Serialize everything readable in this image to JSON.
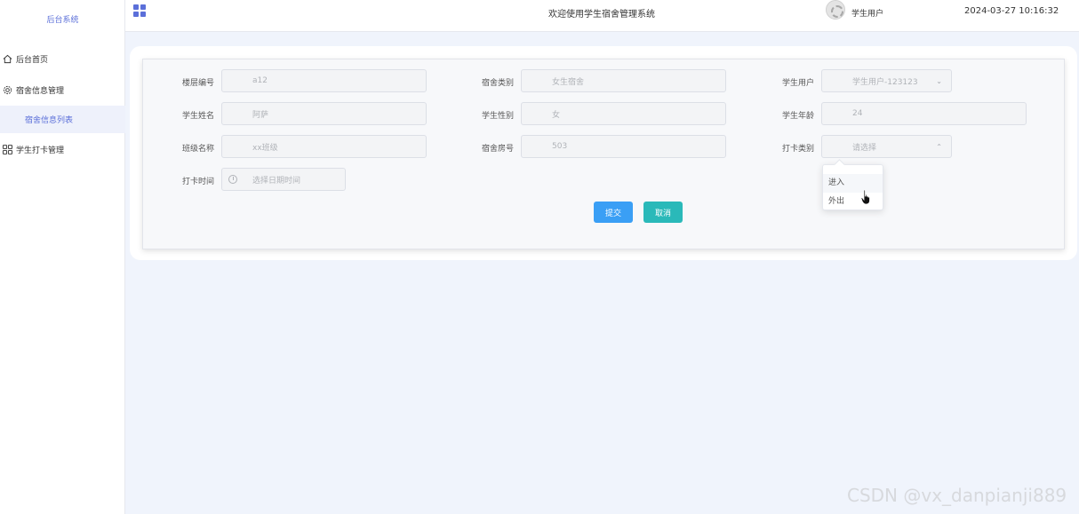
{
  "sidebar": {
    "brand": "后台系统",
    "items": [
      {
        "label": "后台首页",
        "icon": "home-icon"
      },
      {
        "label": "宿舍信息管理",
        "icon": "gear-icon"
      },
      {
        "label": "宿舍信息列表",
        "icon": ""
      },
      {
        "label": "学生打卡管理",
        "icon": "grid-icon"
      }
    ]
  },
  "header": {
    "title": "欢迎使用学生宿舍管理系统",
    "user": "学生用户",
    "datetime": "2024-03-27 10:16:32"
  },
  "form": {
    "fields": [
      {
        "label": "楼层编号",
        "value": "a12"
      },
      {
        "label": "宿舍类别",
        "value": "女生宿舍"
      },
      {
        "label": "学生用户",
        "value": "学生用户-123123"
      },
      {
        "label": "学生姓名",
        "value": "阿萨"
      },
      {
        "label": "学生性别",
        "value": "女"
      },
      {
        "label": "学生年龄",
        "value": "24"
      },
      {
        "label": "班级名称",
        "value": "xx班级"
      },
      {
        "label": "宿舍房号",
        "value": "503"
      },
      {
        "label": "打卡类别",
        "placeholder": "请选择"
      },
      {
        "label": "打卡时间",
        "placeholder": "选择日期时间"
      }
    ],
    "submit_label": "提交",
    "cancel_label": "取消"
  },
  "dropdown": {
    "options": [
      "进入",
      "外出"
    ]
  },
  "watermark": "CSDN @vx_danpianji889",
  "colors": {
    "accent": "#5b6fd9",
    "submit": "#3a9ff5",
    "cancel": "#2ab9b9",
    "background": "#f0f4fc"
  }
}
